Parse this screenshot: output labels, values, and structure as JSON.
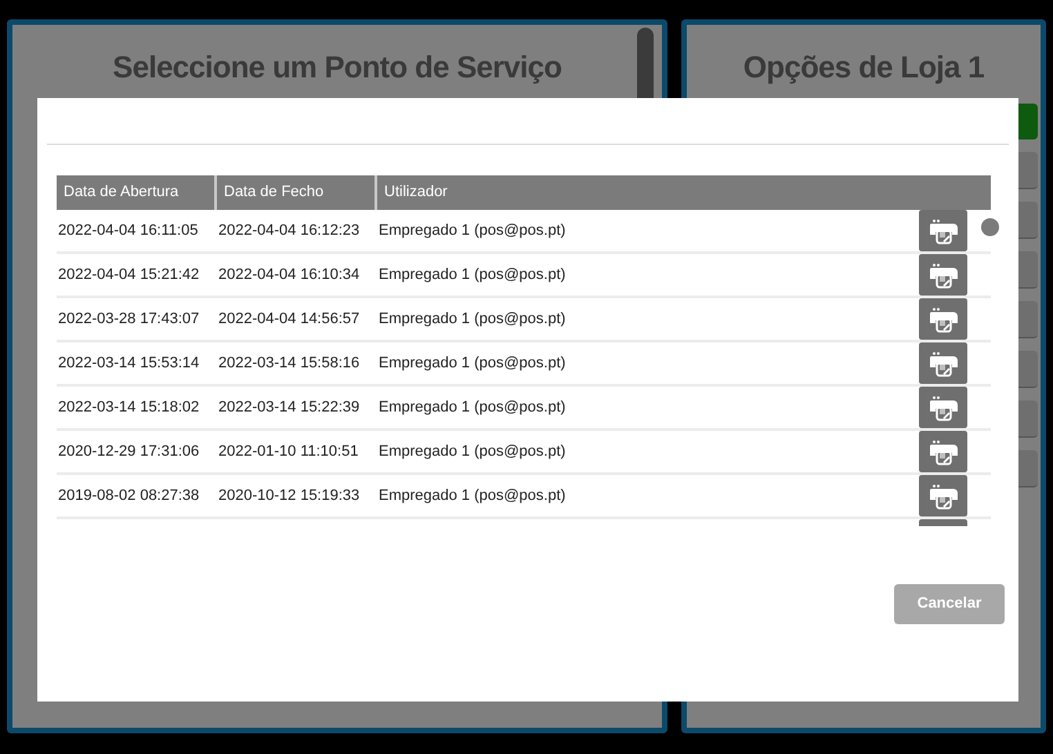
{
  "left_panel": {
    "title": "Seleccione um Ponto de Serviço"
  },
  "right_panel": {
    "title": "Opções de Loja 1"
  },
  "dialog": {
    "table": {
      "columns": [
        "Data de Abertura",
        "Data de Fecho",
        "Utilizador"
      ],
      "rows": [
        {
          "opened": "2022-04-04 16:11:05",
          "closed": "2022-04-04 16:12:23",
          "user": "Empregado 1 (pos@pos.pt)"
        },
        {
          "opened": "2022-04-04 15:21:42",
          "closed": "2022-04-04 16:10:34",
          "user": "Empregado 1 (pos@pos.pt)"
        },
        {
          "opened": "2022-03-28 17:43:07",
          "closed": "2022-04-04 14:56:57",
          "user": "Empregado 1 (pos@pos.pt)"
        },
        {
          "opened": "2022-03-14 15:53:14",
          "closed": "2022-03-14 15:58:16",
          "user": "Empregado 1 (pos@pos.pt)"
        },
        {
          "opened": "2022-03-14 15:18:02",
          "closed": "2022-03-14 15:22:39",
          "user": "Empregado 1 (pos@pos.pt)"
        },
        {
          "opened": "2020-12-29 17:31:06",
          "closed": "2022-01-10 11:10:51",
          "user": "Empregado 1 (pos@pos.pt)"
        },
        {
          "opened": "2019-08-02 08:27:38",
          "closed": "2020-10-12 15:19:33",
          "user": "Empregado 1 (pos@pos.pt)"
        }
      ]
    },
    "cancel_button": "Cancelar"
  }
}
